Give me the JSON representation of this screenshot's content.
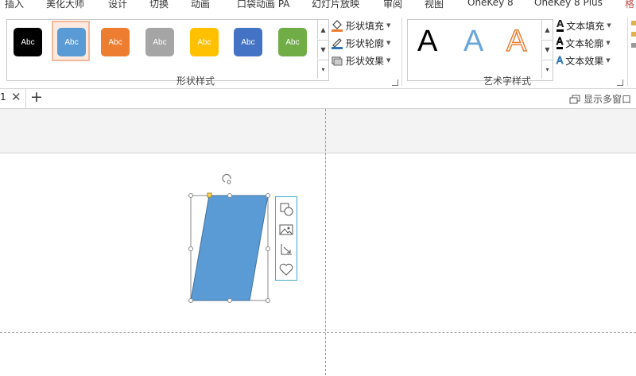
{
  "ribbon_tabs": [
    "插入",
    "美化大师",
    "设计",
    "切换",
    "动画",
    "口袋动画 PA",
    "幻灯片放映",
    "审阅",
    "视图",
    "OneKey 8",
    "OneKey 8 Plus",
    "格"
  ],
  "shape_styles": {
    "swatches": [
      {
        "label": "Abc",
        "fill": "#000000",
        "text": "#ffffff"
      },
      {
        "label": "Abc",
        "fill": "#5b9bd5",
        "text": "#ffffff",
        "selected": true
      },
      {
        "label": "Abc",
        "fill": "#ed7d31",
        "text": "#ffffff"
      },
      {
        "label": "Abc",
        "fill": "#a5a5a5",
        "text": "#ffffff"
      },
      {
        "label": "Abc",
        "fill": "#ffc000",
        "text": "#ffffff"
      },
      {
        "label": "Abc",
        "fill": "#4472c4",
        "text": "#ffffff"
      },
      {
        "label": "Abc",
        "fill": "#70ad47",
        "text": "#ffffff"
      }
    ],
    "fill": "形状填充",
    "outline": "形状轮廓",
    "effect": "形状效果",
    "group_label": "形状样式"
  },
  "wordart": {
    "samples": [
      "A",
      "A",
      "A"
    ],
    "text_fill": "文本填充",
    "text_outline": "文本轮廓",
    "text_effect": "文本效果",
    "group_label": "艺术字样式"
  },
  "doc_tab": {
    "label": "1"
  },
  "show_multiwindow": "显示多窗口",
  "shape_color": "#5b9bd5",
  "accent": "#3fa9c8"
}
